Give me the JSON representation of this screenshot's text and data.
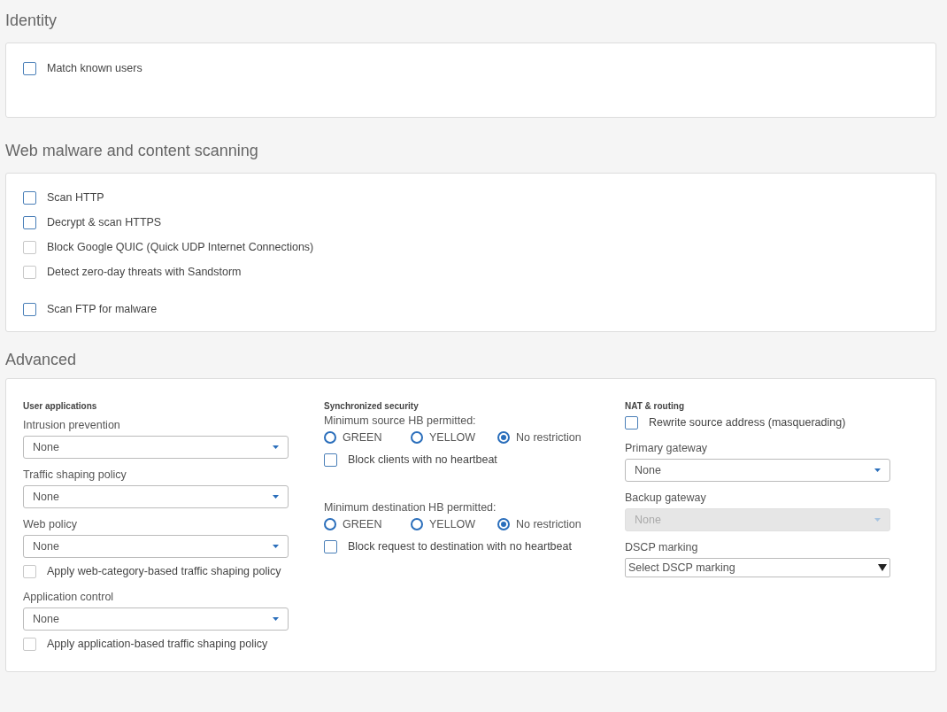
{
  "sections": [
    {
      "title": "Identity",
      "items": [
        {
          "kind": "checkbox",
          "label": "Match known users",
          "checked": false,
          "disabled": false
        }
      ]
    },
    {
      "title": "Web malware and content scanning",
      "items": [
        {
          "kind": "checkbox",
          "label": "Scan HTTP",
          "checked": false,
          "disabled": false
        },
        {
          "kind": "checkbox",
          "label": "Decrypt & scan HTTPS",
          "checked": false,
          "disabled": false
        },
        {
          "kind": "checkbox",
          "label": "Block Google QUIC (Quick UDP Internet Connections)",
          "checked": false,
          "disabled": true
        },
        {
          "kind": "checkbox",
          "label": "Detect zero-day threats with Sandstorm",
          "checked": false,
          "disabled": true
        },
        {
          "kind": "checkbox",
          "label": "Scan FTP for malware",
          "checked": false,
          "disabled": false
        }
      ]
    }
  ],
  "advanced": {
    "title": "Advanced",
    "columns": [
      {
        "title": "User applications",
        "items": [
          {
            "kind": "select",
            "label": "Intrusion prevention",
            "value": "None",
            "disabled": false
          },
          {
            "kind": "select",
            "label": "Traffic shaping policy",
            "value": "None",
            "disabled": false
          },
          {
            "kind": "select",
            "label": "Web policy",
            "value": "None",
            "disabled": false
          },
          {
            "kind": "checkbox",
            "label": "Apply web-category-based traffic shaping policy",
            "checked": false,
            "disabled": true
          },
          {
            "kind": "select",
            "label": "Application control",
            "value": "None",
            "disabled": false
          },
          {
            "kind": "checkbox",
            "label": "Apply application-based traffic shaping policy",
            "checked": false,
            "disabled": true
          }
        ]
      },
      {
        "title": "Synchronized security",
        "items": [
          {
            "kind": "radio",
            "label": "Minimum source HB permitted:",
            "options": [
              {
                "label": "GREEN",
                "selected": false
              },
              {
                "label": "YELLOW",
                "selected": false
              },
              {
                "label": "No restriction",
                "selected": true
              }
            ]
          },
          {
            "kind": "checkbox",
            "label": "Block clients with no heartbeat",
            "checked": false,
            "disabled": false
          },
          {
            "kind": "radio",
            "label": "Minimum destination HB permitted:",
            "options": [
              {
                "label": "GREEN",
                "selected": false
              },
              {
                "label": "YELLOW",
                "selected": false
              },
              {
                "label": "No restriction",
                "selected": true
              }
            ]
          },
          {
            "kind": "checkbox",
            "label": "Block request to destination with no heartbeat",
            "checked": false,
            "disabled": false
          }
        ]
      },
      {
        "title": "NAT & routing",
        "items": [
          {
            "kind": "checkbox",
            "label": "Rewrite source address (masquerading)",
            "checked": false,
            "disabled": false
          },
          {
            "kind": "select",
            "label": "Primary gateway",
            "value": "None",
            "disabled": false
          },
          {
            "kind": "select",
            "label": "Backup gateway",
            "value": "None",
            "disabled": true
          },
          {
            "kind": "native_select",
            "label": "DSCP marking",
            "value": "Select DSCP marking",
            "disabled": false
          }
        ]
      }
    ]
  }
}
